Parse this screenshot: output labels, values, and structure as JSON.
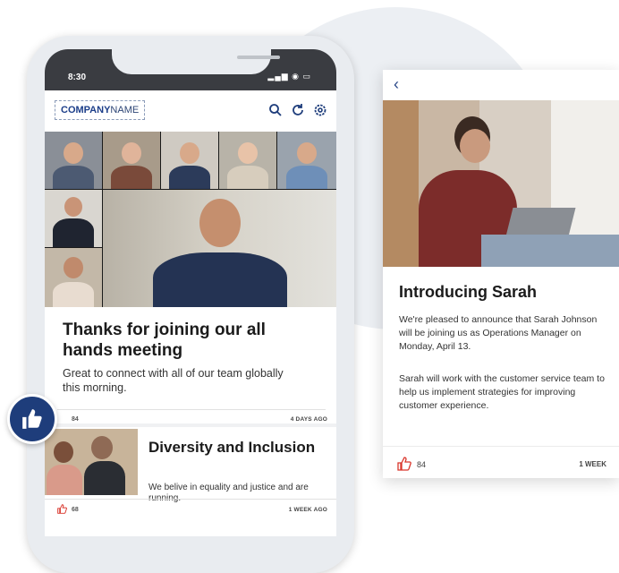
{
  "phone": {
    "status": {
      "time": "8:30"
    },
    "appbar": {
      "logo_bold": "COMPANY",
      "logo_rest": "NAME"
    },
    "card1": {
      "title": "Thanks for joining our all hands meeting",
      "text": "Great to connect with all of our team globally this morning.",
      "likes": "84",
      "time": "4 DAYS AGO"
    },
    "card2": {
      "title": "Diversity and Inclusion",
      "text": "We belive in equality and justice and are running.",
      "likes": "68",
      "time": "1 WEEK AGO"
    }
  },
  "sidecard": {
    "title": "Introducing Sarah",
    "p1": "We're pleased to announce that Sarah Johnson will be joining us as Operations Manager on Monday, April 13.",
    "p2": "Sarah will work with the customer service team to help us implement strategies for improving customer experience.",
    "likes": "84",
    "time": "1 WEEK"
  },
  "colors": {
    "brand": "#1e3d7b",
    "like": "#d9352b"
  },
  "icons": [
    "search-icon",
    "refresh-icon",
    "settings-icon",
    "thumbs-up-icon",
    "back-chevron-icon"
  ]
}
